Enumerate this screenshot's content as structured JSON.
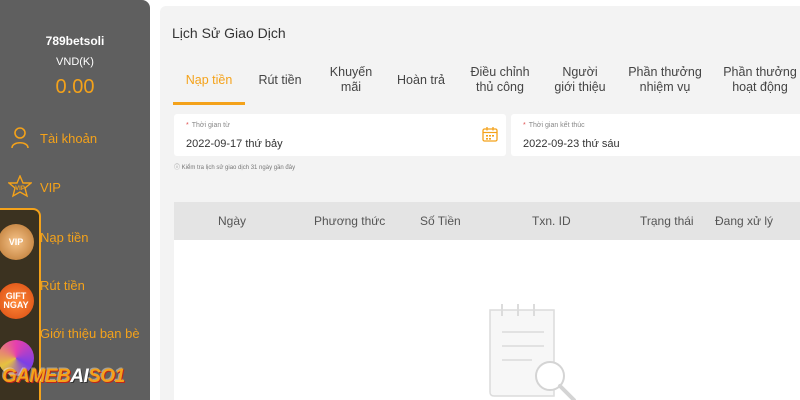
{
  "sidebar": {
    "username": "789betsoli",
    "currency": "VND(K)",
    "balance": "0.00",
    "items": [
      {
        "label": "Tài khoản",
        "icon": "user-icon"
      },
      {
        "label": "VIP",
        "icon": "vip-star-icon"
      }
    ],
    "promos": [
      {
        "label": "Nạp tiền",
        "badge": "VIP",
        "icon": "vip-badge-icon"
      },
      {
        "label": "Rút tiền",
        "badge": "GIFT\nNGAY",
        "icon": "gift-badge-icon"
      },
      {
        "label": "Giới thiệu bạn bè",
        "badge": "",
        "icon": "wheel-badge-icon"
      }
    ]
  },
  "watermark": {
    "part1": "GAMEB",
    "part2": "AI",
    "part3": "SO1"
  },
  "main": {
    "title": "Lịch Sử Giao Dịch",
    "tabs": [
      {
        "label": "Nạp tiền",
        "active": true
      },
      {
        "label": "Rút tiền"
      },
      {
        "label": "Khuyến\nmãi"
      },
      {
        "label": "Hoàn trả"
      },
      {
        "label": "Điều chỉnh\nthủ công"
      },
      {
        "label": "Người\ngiới thiệu"
      },
      {
        "label": "Phần thưởng\nnhiệm vụ"
      },
      {
        "label": "Phần thưởng\nhoạt động"
      }
    ],
    "date_from": {
      "label": "Thời gian từ",
      "value": "2022-09-17 thứ bảy"
    },
    "date_to": {
      "label": "Thời gian kết thúc",
      "value": "2022-09-23 thứ sáu"
    },
    "hint": "Kiểm tra lịch sử giao dịch 31 ngày gần đây",
    "columns": [
      "Ngày",
      "Phương thức",
      "Số Tiền",
      "Txn. ID",
      "Trạng thái",
      "Đang xử lý"
    ],
    "accent_color": "#f4a21a"
  }
}
